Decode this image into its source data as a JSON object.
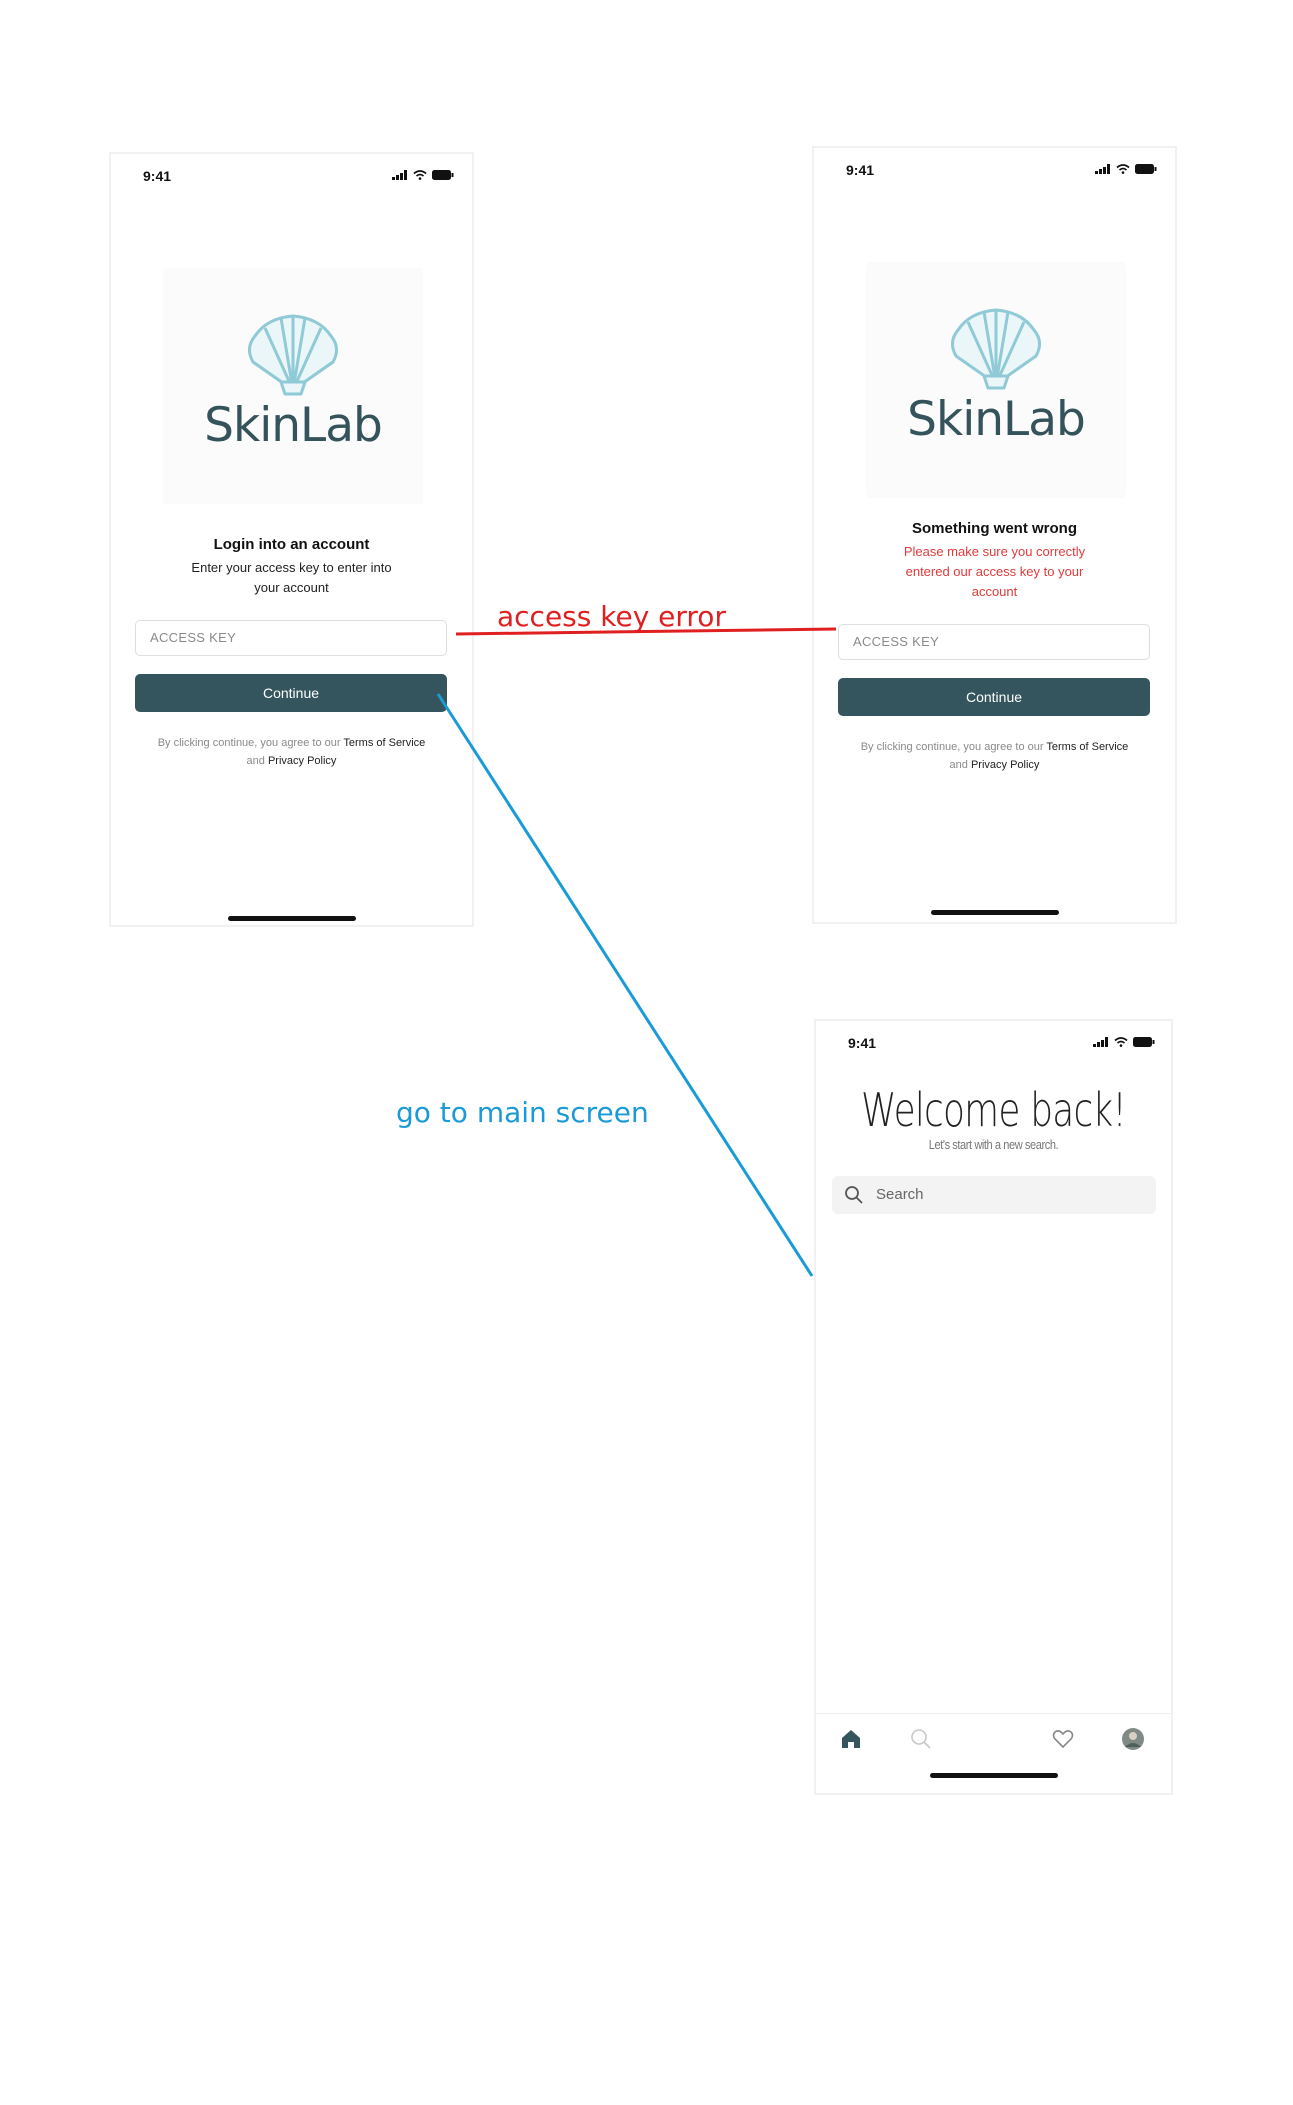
{
  "status_bar": {
    "time": "9:41"
  },
  "brand": {
    "name": "SkinLab"
  },
  "login_screen": {
    "title": "Login into an account",
    "subtitle_line1": "Enter your access key to enter into",
    "subtitle_line2": "your account",
    "input_placeholder": "ACCESS KEY",
    "continue_label": "Continue",
    "terms_prefix": "By clicking continue, you agree to our ",
    "terms_link": "Terms of Service",
    "terms_and": "and ",
    "privacy_link": "Privacy Policy"
  },
  "error_screen": {
    "title": "Something went wrong",
    "error_line1": "Please make sure you correctly",
    "error_line2": "entered our access key to your",
    "error_line3": "account",
    "input_placeholder": "ACCESS KEY",
    "continue_label": "Continue",
    "terms_prefix": "By clicking continue, you agree to our ",
    "terms_link": "Terms of Service",
    "terms_and": "and ",
    "privacy_link": "Privacy Policy"
  },
  "main_screen": {
    "welcome_title": "Welcome back!",
    "welcome_subtitle": "Let's start with a new search.",
    "search_placeholder": "Search",
    "tabs": [
      {
        "icon": "home-icon"
      },
      {
        "icon": "search-icon"
      },
      {
        "icon": "heart-icon"
      },
      {
        "icon": "avatar"
      }
    ]
  },
  "annotations": {
    "error_flow": "access key error",
    "main_flow": "go to main screen"
  },
  "colors": {
    "primary": "#34555d",
    "brand_text": "#34535b",
    "shell": "#8fcad6",
    "error_text": "#e03b3b",
    "annotation_red": "#e02020",
    "annotation_blue": "#1a9bd8"
  }
}
